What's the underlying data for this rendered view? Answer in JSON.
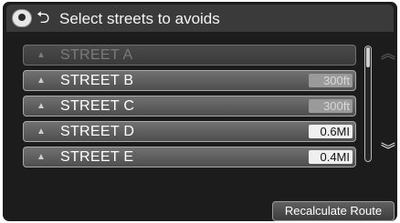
{
  "header": {
    "title": "Select streets to avoids"
  },
  "streets": [
    {
      "name": "STREET A",
      "distance": "",
      "enabled": false
    },
    {
      "name": "STREET B",
      "distance": "300ft",
      "enabled": true
    },
    {
      "name": "STREET C",
      "distance": "300ft",
      "enabled": true
    },
    {
      "name": "STREET D",
      "distance": "0.6MI",
      "enabled": true
    },
    {
      "name": "STREET E",
      "distance": "0.4MI",
      "enabled": true
    }
  ],
  "scroll": {
    "up_icon": "chevron-double-up-icon",
    "down_icon": "chevron-double-down-icon"
  },
  "footer": {
    "recalculate_label": "Recalculate Route"
  }
}
